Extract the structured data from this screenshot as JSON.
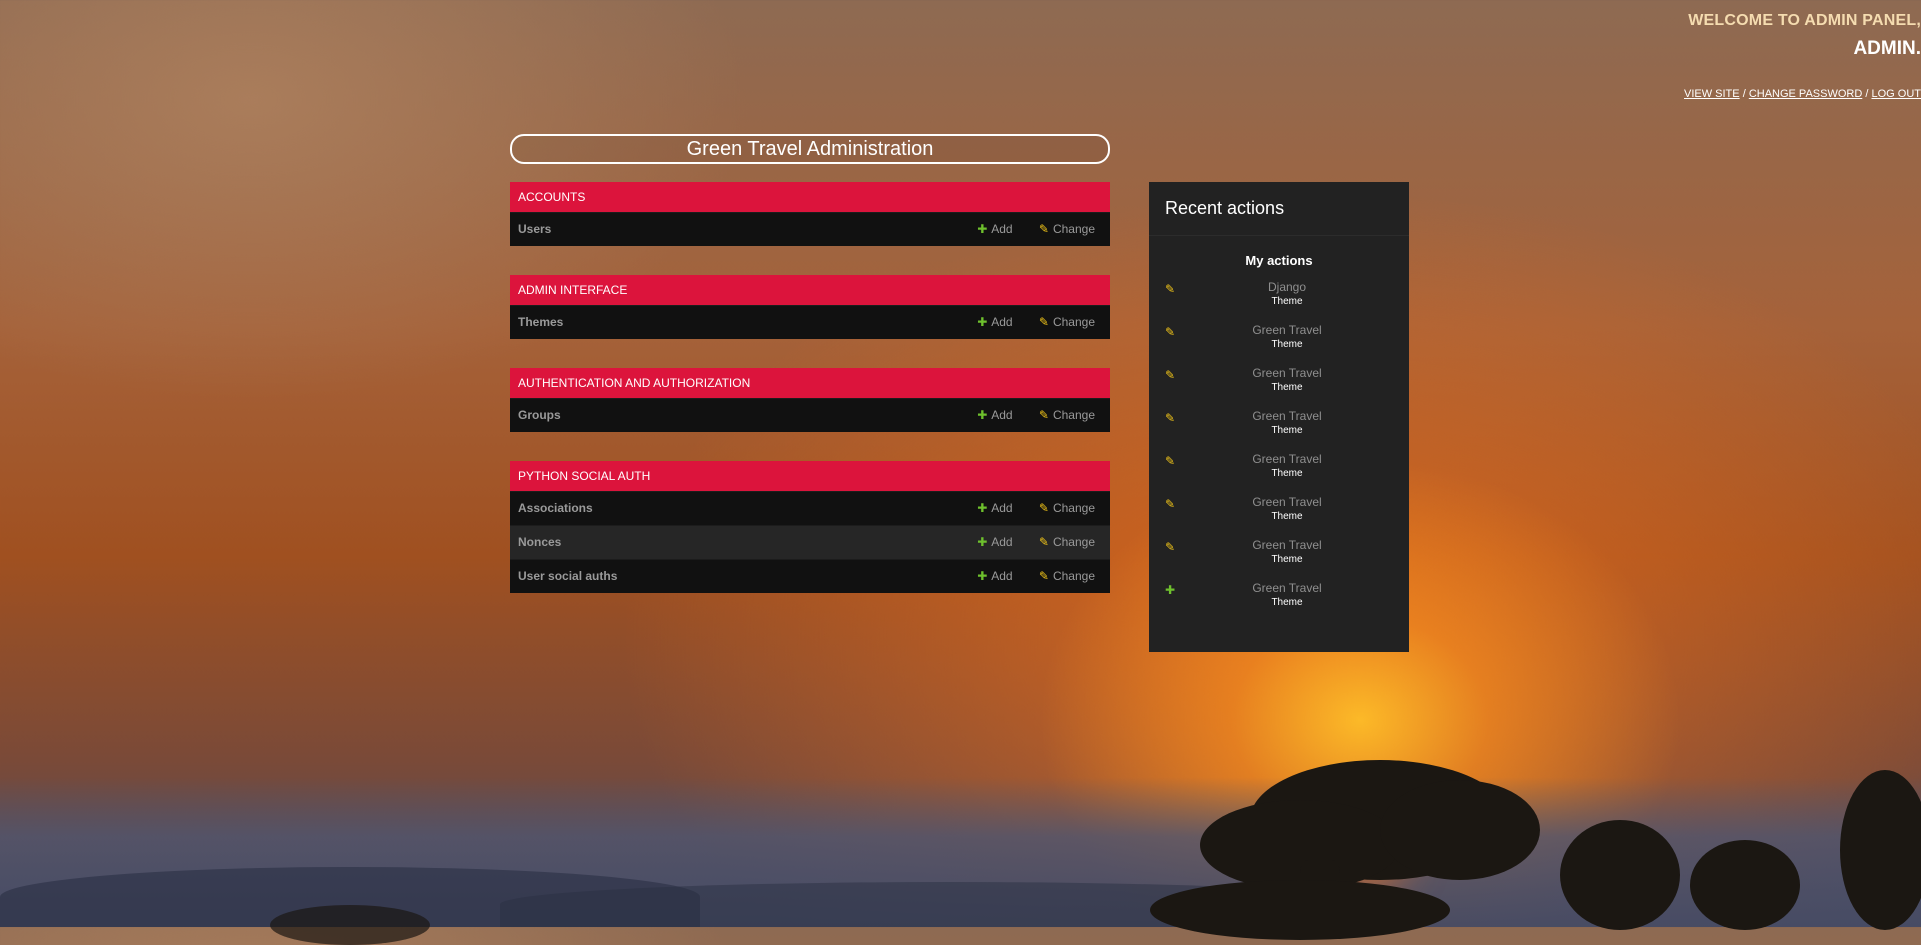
{
  "header": {
    "welcome": "WELCOME TO ADMIN PANEL,",
    "username": "ADMIN",
    "username_suffix": ".",
    "links": [
      {
        "label": "VIEW SITE"
      },
      {
        "label": "CHANGE PASSWORD"
      },
      {
        "label": "LOG OUT"
      }
    ],
    "separator": "/"
  },
  "site_title": "Green Travel Administration",
  "row_actions": {
    "add": "Add",
    "change": "Change"
  },
  "icons": {
    "add": "plus-icon",
    "change": "pencil-icon"
  },
  "colors": {
    "module_header": "#dc143c",
    "add": "#6ec02d",
    "change": "#f0c419"
  },
  "modules": [
    {
      "caption": "ACCOUNTS",
      "models": [
        {
          "name": "Users"
        }
      ]
    },
    {
      "caption": "ADMIN INTERFACE",
      "models": [
        {
          "name": "Themes"
        }
      ]
    },
    {
      "caption": "AUTHENTICATION AND AUTHORIZATION",
      "models": [
        {
          "name": "Groups"
        }
      ]
    },
    {
      "caption": "PYTHON SOCIAL AUTH",
      "models": [
        {
          "name": "Associations"
        },
        {
          "name": "Nonces"
        },
        {
          "name": "User social auths"
        }
      ]
    }
  ],
  "recent_actions": {
    "title": "Recent actions",
    "subtitle": "My actions",
    "items": [
      {
        "type": "change",
        "object": "Django",
        "content_type": "Theme"
      },
      {
        "type": "change",
        "object": "Green Travel",
        "content_type": "Theme"
      },
      {
        "type": "change",
        "object": "Green Travel",
        "content_type": "Theme"
      },
      {
        "type": "change",
        "object": "Green Travel",
        "content_type": "Theme"
      },
      {
        "type": "change",
        "object": "Green Travel",
        "content_type": "Theme"
      },
      {
        "type": "change",
        "object": "Green Travel",
        "content_type": "Theme"
      },
      {
        "type": "change",
        "object": "Green Travel",
        "content_type": "Theme"
      },
      {
        "type": "add",
        "object": "Green Travel",
        "content_type": "Theme"
      }
    ]
  }
}
